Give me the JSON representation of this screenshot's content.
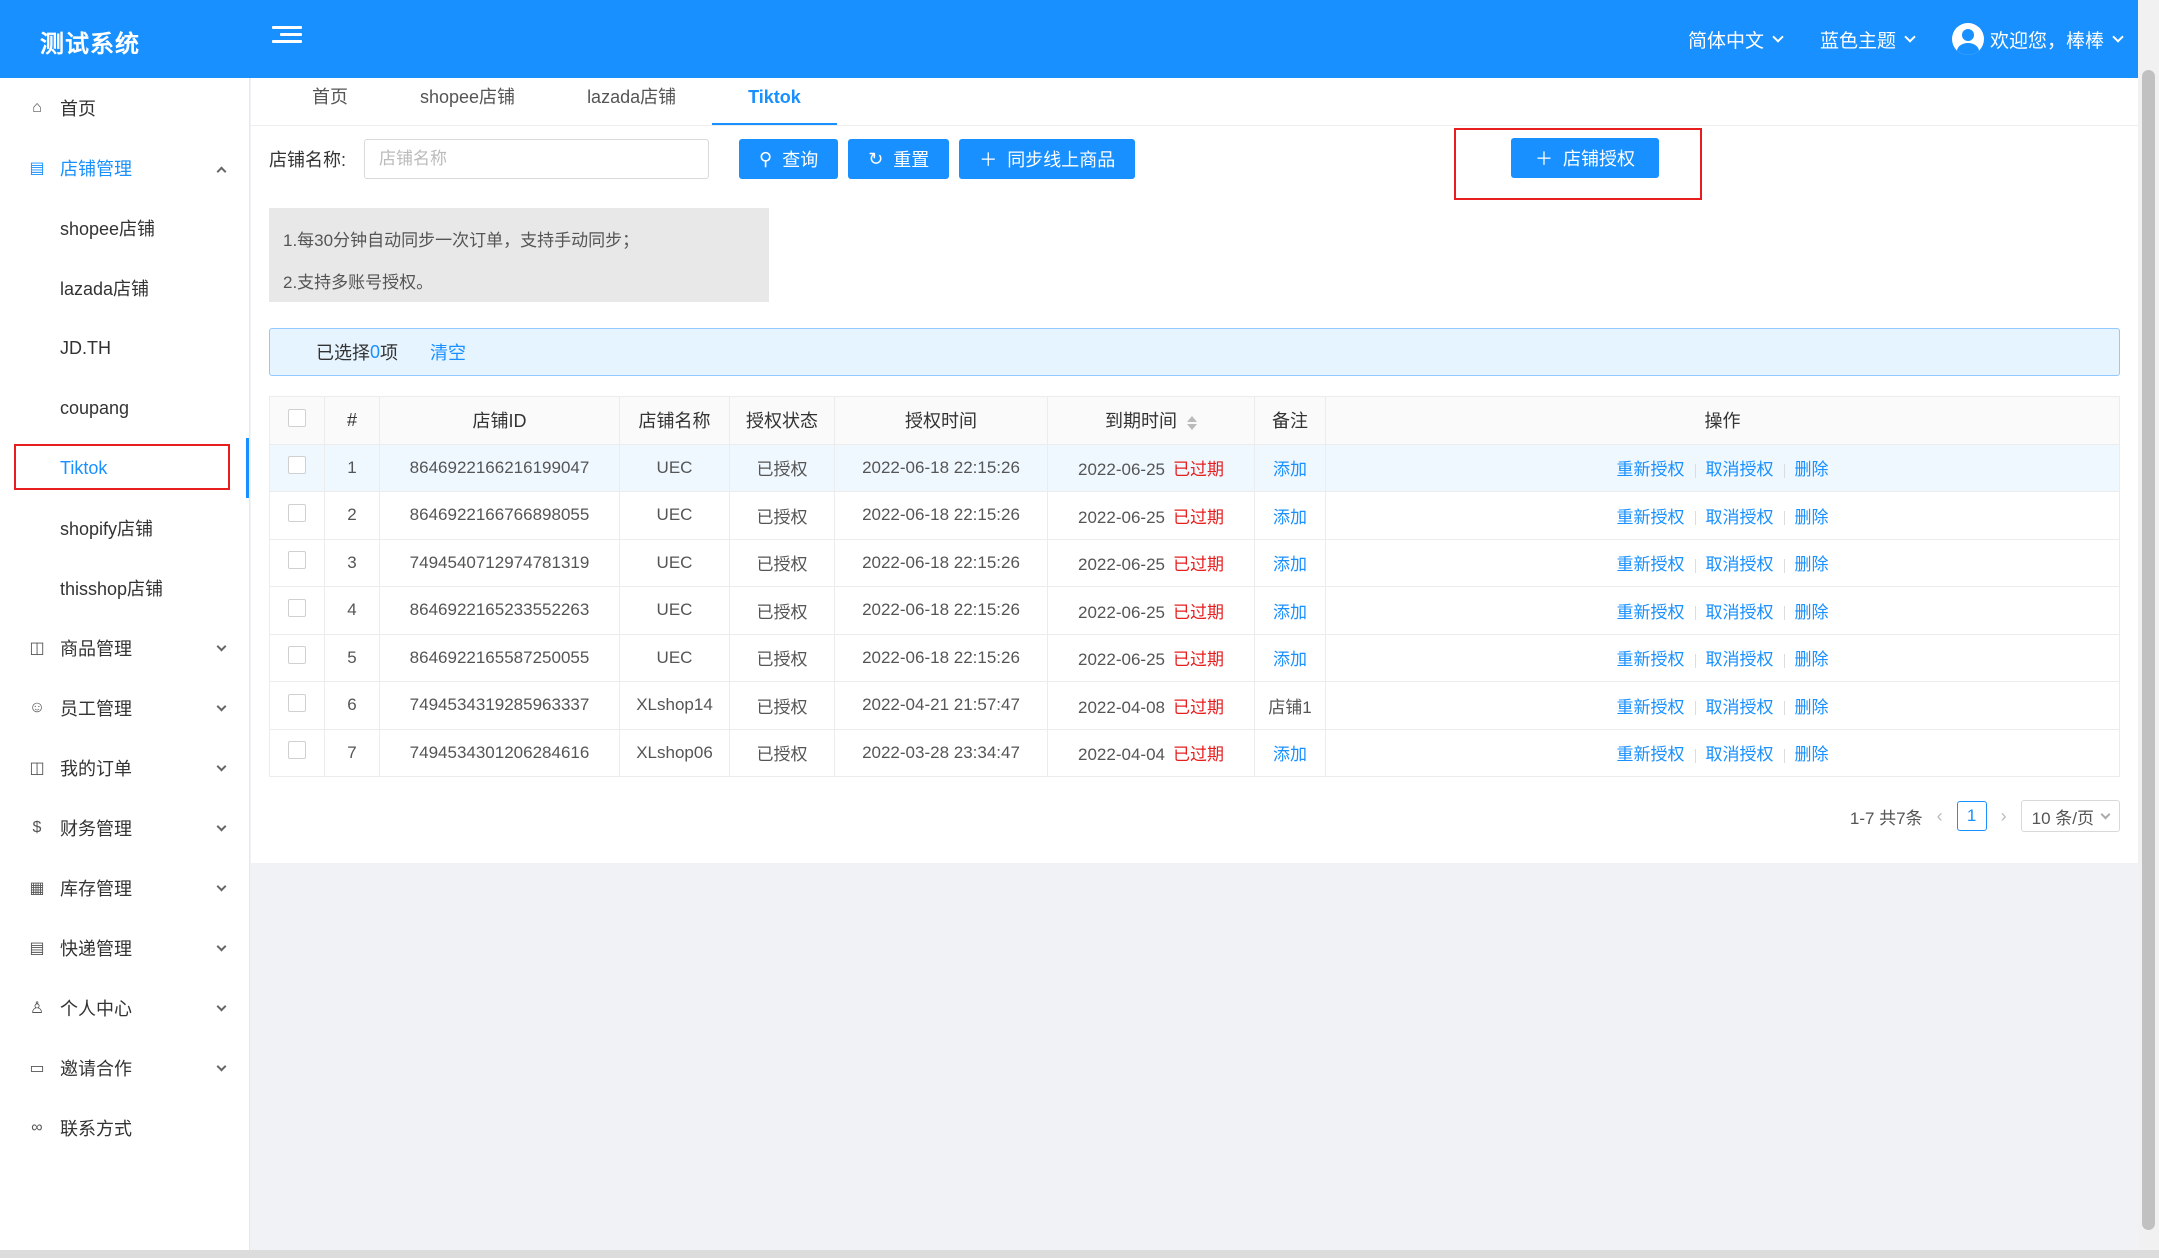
{
  "app": {
    "title": "测试系统",
    "language": "简体中文",
    "theme": "蓝色主题",
    "welcome": "欢迎您，棒棒"
  },
  "sidebar": {
    "items": [
      {
        "label": "首页",
        "icon": "home-icon"
      },
      {
        "label": "店铺管理",
        "icon": "store-icon",
        "open": true,
        "children": [
          "shopee店铺",
          "lazada店铺",
          "JD.TH",
          "coupang",
          "Tiktok",
          "shopify店铺",
          "thisshop店铺"
        ]
      },
      {
        "label": "商品管理",
        "icon": "bag-icon"
      },
      {
        "label": "员工管理",
        "icon": "team-icon"
      },
      {
        "label": "我的订单",
        "icon": "order-icon"
      },
      {
        "label": "财务管理",
        "icon": "money-icon"
      },
      {
        "label": "库存管理",
        "icon": "table-icon"
      },
      {
        "label": "快递管理",
        "icon": "list-icon"
      },
      {
        "label": "个人中心",
        "icon": "user-icon"
      },
      {
        "label": "邀请合作",
        "icon": "laptop-icon"
      },
      {
        "label": "联系方式",
        "icon": "link-icon"
      }
    ],
    "active_child": "Tiktok"
  },
  "tabs": [
    "首页",
    "shopee店铺",
    "lazada店铺",
    "Tiktok"
  ],
  "active_tab": "Tiktok",
  "filter": {
    "label": "店铺名称:",
    "placeholder": "店铺名称",
    "query": "查询",
    "reset": "重置",
    "sync": "同步线上商品",
    "authorize": "店铺授权"
  },
  "tips": [
    "1.每30分钟自动同步一次订单，支持手动同步；",
    "2.支持多账号授权。"
  ],
  "selection": {
    "prefix": "已选择",
    "count": "0",
    "suffix": "项",
    "clear": "清空"
  },
  "table": {
    "columns": [
      "#",
      "店铺ID",
      "店铺名称",
      "授权状态",
      "授权时间",
      "到期时间",
      "备注",
      "操作"
    ],
    "rows": [
      {
        "no": "1",
        "id": "8646922166216199047",
        "name": "UEC",
        "status": "已授权",
        "auth_time": "2022-06-18 22:15:26",
        "expire": "2022-06-25",
        "expired": "已过期",
        "remark": "添加"
      },
      {
        "no": "2",
        "id": "8646922166766898055",
        "name": "UEC",
        "status": "已授权",
        "auth_time": "2022-06-18 22:15:26",
        "expire": "2022-06-25",
        "expired": "已过期",
        "remark": "添加"
      },
      {
        "no": "3",
        "id": "7494540712974781319",
        "name": "UEC",
        "status": "已授权",
        "auth_time": "2022-06-18 22:15:26",
        "expire": "2022-06-25",
        "expired": "已过期",
        "remark": "添加"
      },
      {
        "no": "4",
        "id": "8646922165233552263",
        "name": "UEC",
        "status": "已授权",
        "auth_time": "2022-06-18 22:15:26",
        "expire": "2022-06-25",
        "expired": "已过期",
        "remark": "添加"
      },
      {
        "no": "5",
        "id": "8646922165587250055",
        "name": "UEC",
        "status": "已授权",
        "auth_time": "2022-06-18 22:15:26",
        "expire": "2022-06-25",
        "expired": "已过期",
        "remark": "添加"
      },
      {
        "no": "6",
        "id": "7494534319285963337",
        "name": "XLshop14",
        "status": "已授权",
        "auth_time": "2022-04-21 21:57:47",
        "expire": "2022-04-08",
        "expired": "已过期",
        "remark": "店铺1"
      },
      {
        "no": "7",
        "id": "7494534301206284616",
        "name": "XLshop06",
        "status": "已授权",
        "auth_time": "2022-03-28 23:34:47",
        "expire": "2022-04-04",
        "expired": "已过期",
        "remark": "添加"
      }
    ],
    "actions": {
      "reauth": "重新授权",
      "cancel": "取消授权",
      "delete": "删除"
    }
  },
  "pagination": {
    "total": "1-7 共7条",
    "current": "1",
    "page_size": "10 条/页"
  },
  "colors": {
    "primary": "#1890ff",
    "danger": "#e61e1e"
  }
}
